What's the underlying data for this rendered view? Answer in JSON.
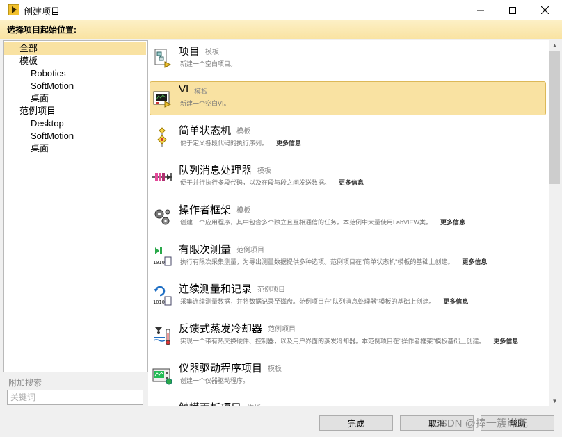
{
  "window": {
    "title": "创建项目",
    "minimize_glyph": "—",
    "maximize_glyph": "☐",
    "close_glyph": "✕"
  },
  "header": {
    "text": "选择项目起始位置:"
  },
  "tree": {
    "items": [
      {
        "label": "全部",
        "indent": 0,
        "selected": true
      },
      {
        "label": "模板",
        "indent": 0
      },
      {
        "label": "Robotics",
        "indent": 1
      },
      {
        "label": "SoftMotion",
        "indent": 1
      },
      {
        "label": "桌面",
        "indent": 1
      },
      {
        "label": "范例项目",
        "indent": 0
      },
      {
        "label": "Desktop",
        "indent": 1
      },
      {
        "label": "SoftMotion",
        "indent": 1
      },
      {
        "label": "桌面",
        "indent": 1
      }
    ]
  },
  "search": {
    "label": "附加搜索",
    "placeholder": "关键词"
  },
  "list": {
    "more_label": "更多信息",
    "items": [
      {
        "title": "项目",
        "tag": "模板",
        "desc": "新建一个空白项目。",
        "icon": "project-icon",
        "more": false
      },
      {
        "title": "VI",
        "tag": "模板",
        "desc": "新建一个空白VI。",
        "icon": "vi-icon",
        "more": false,
        "selected": true
      },
      {
        "title": "简单状态机",
        "tag": "模板",
        "desc": "便于定义各段代码的执行序列。",
        "icon": "state-machine-icon",
        "more": true
      },
      {
        "title": "队列消息处理器",
        "tag": "模板",
        "desc": "便于并行执行多段代码，以及在段与段之间发送数据。",
        "icon": "queue-icon",
        "more": true
      },
      {
        "title": "操作者框架",
        "tag": "模板",
        "desc": "创建一个应用程序，其中包含多个独立且互相通信的任务。本范例中大量使用LabVIEW类。",
        "icon": "gears-icon",
        "more": true
      },
      {
        "title": "有限次测量",
        "tag": "范例项目",
        "desc": "执行有限次采集测量，为导出测量数据提供多种选项。范例项目在\"简单状态机\"模板的基础上创建。",
        "icon": "finite-measure-icon",
        "more": true
      },
      {
        "title": "连续测量和记录",
        "tag": "范例项目",
        "desc": "采集连续测量数据，并将数据记录至磁盘。范例项目在\"队列消息处理器\"模板的基础上创建。",
        "icon": "continuous-measure-icon",
        "more": true
      },
      {
        "title": "反馈式蒸发冷却器",
        "tag": "范例项目",
        "desc": "实现一个带有热交换硬件、控制器，以及用户界面的蒸发冷却器。本范例项目在\"操作者框架\"模板基础上创建。",
        "icon": "cooler-icon",
        "more": true
      },
      {
        "title": "仪器驱动程序项目",
        "tag": "模板",
        "desc": "创建一个仪器驱动程序。",
        "icon": "instrument-icon",
        "more": false
      },
      {
        "title": "触摸面板项目",
        "tag": "模板",
        "desc": "",
        "icon": "touch-panel-icon",
        "more": false
      }
    ]
  },
  "buttons": {
    "finish": "完成",
    "cancel": "取消",
    "help": "帮助"
  },
  "watermark": "CSDN @捧一簇岸花",
  "colors": {
    "accent": "#f9e2a2",
    "accent_border": "#dcb858",
    "header_top": "#fdf0c6",
    "header_bottom": "#f9e3a2"
  }
}
